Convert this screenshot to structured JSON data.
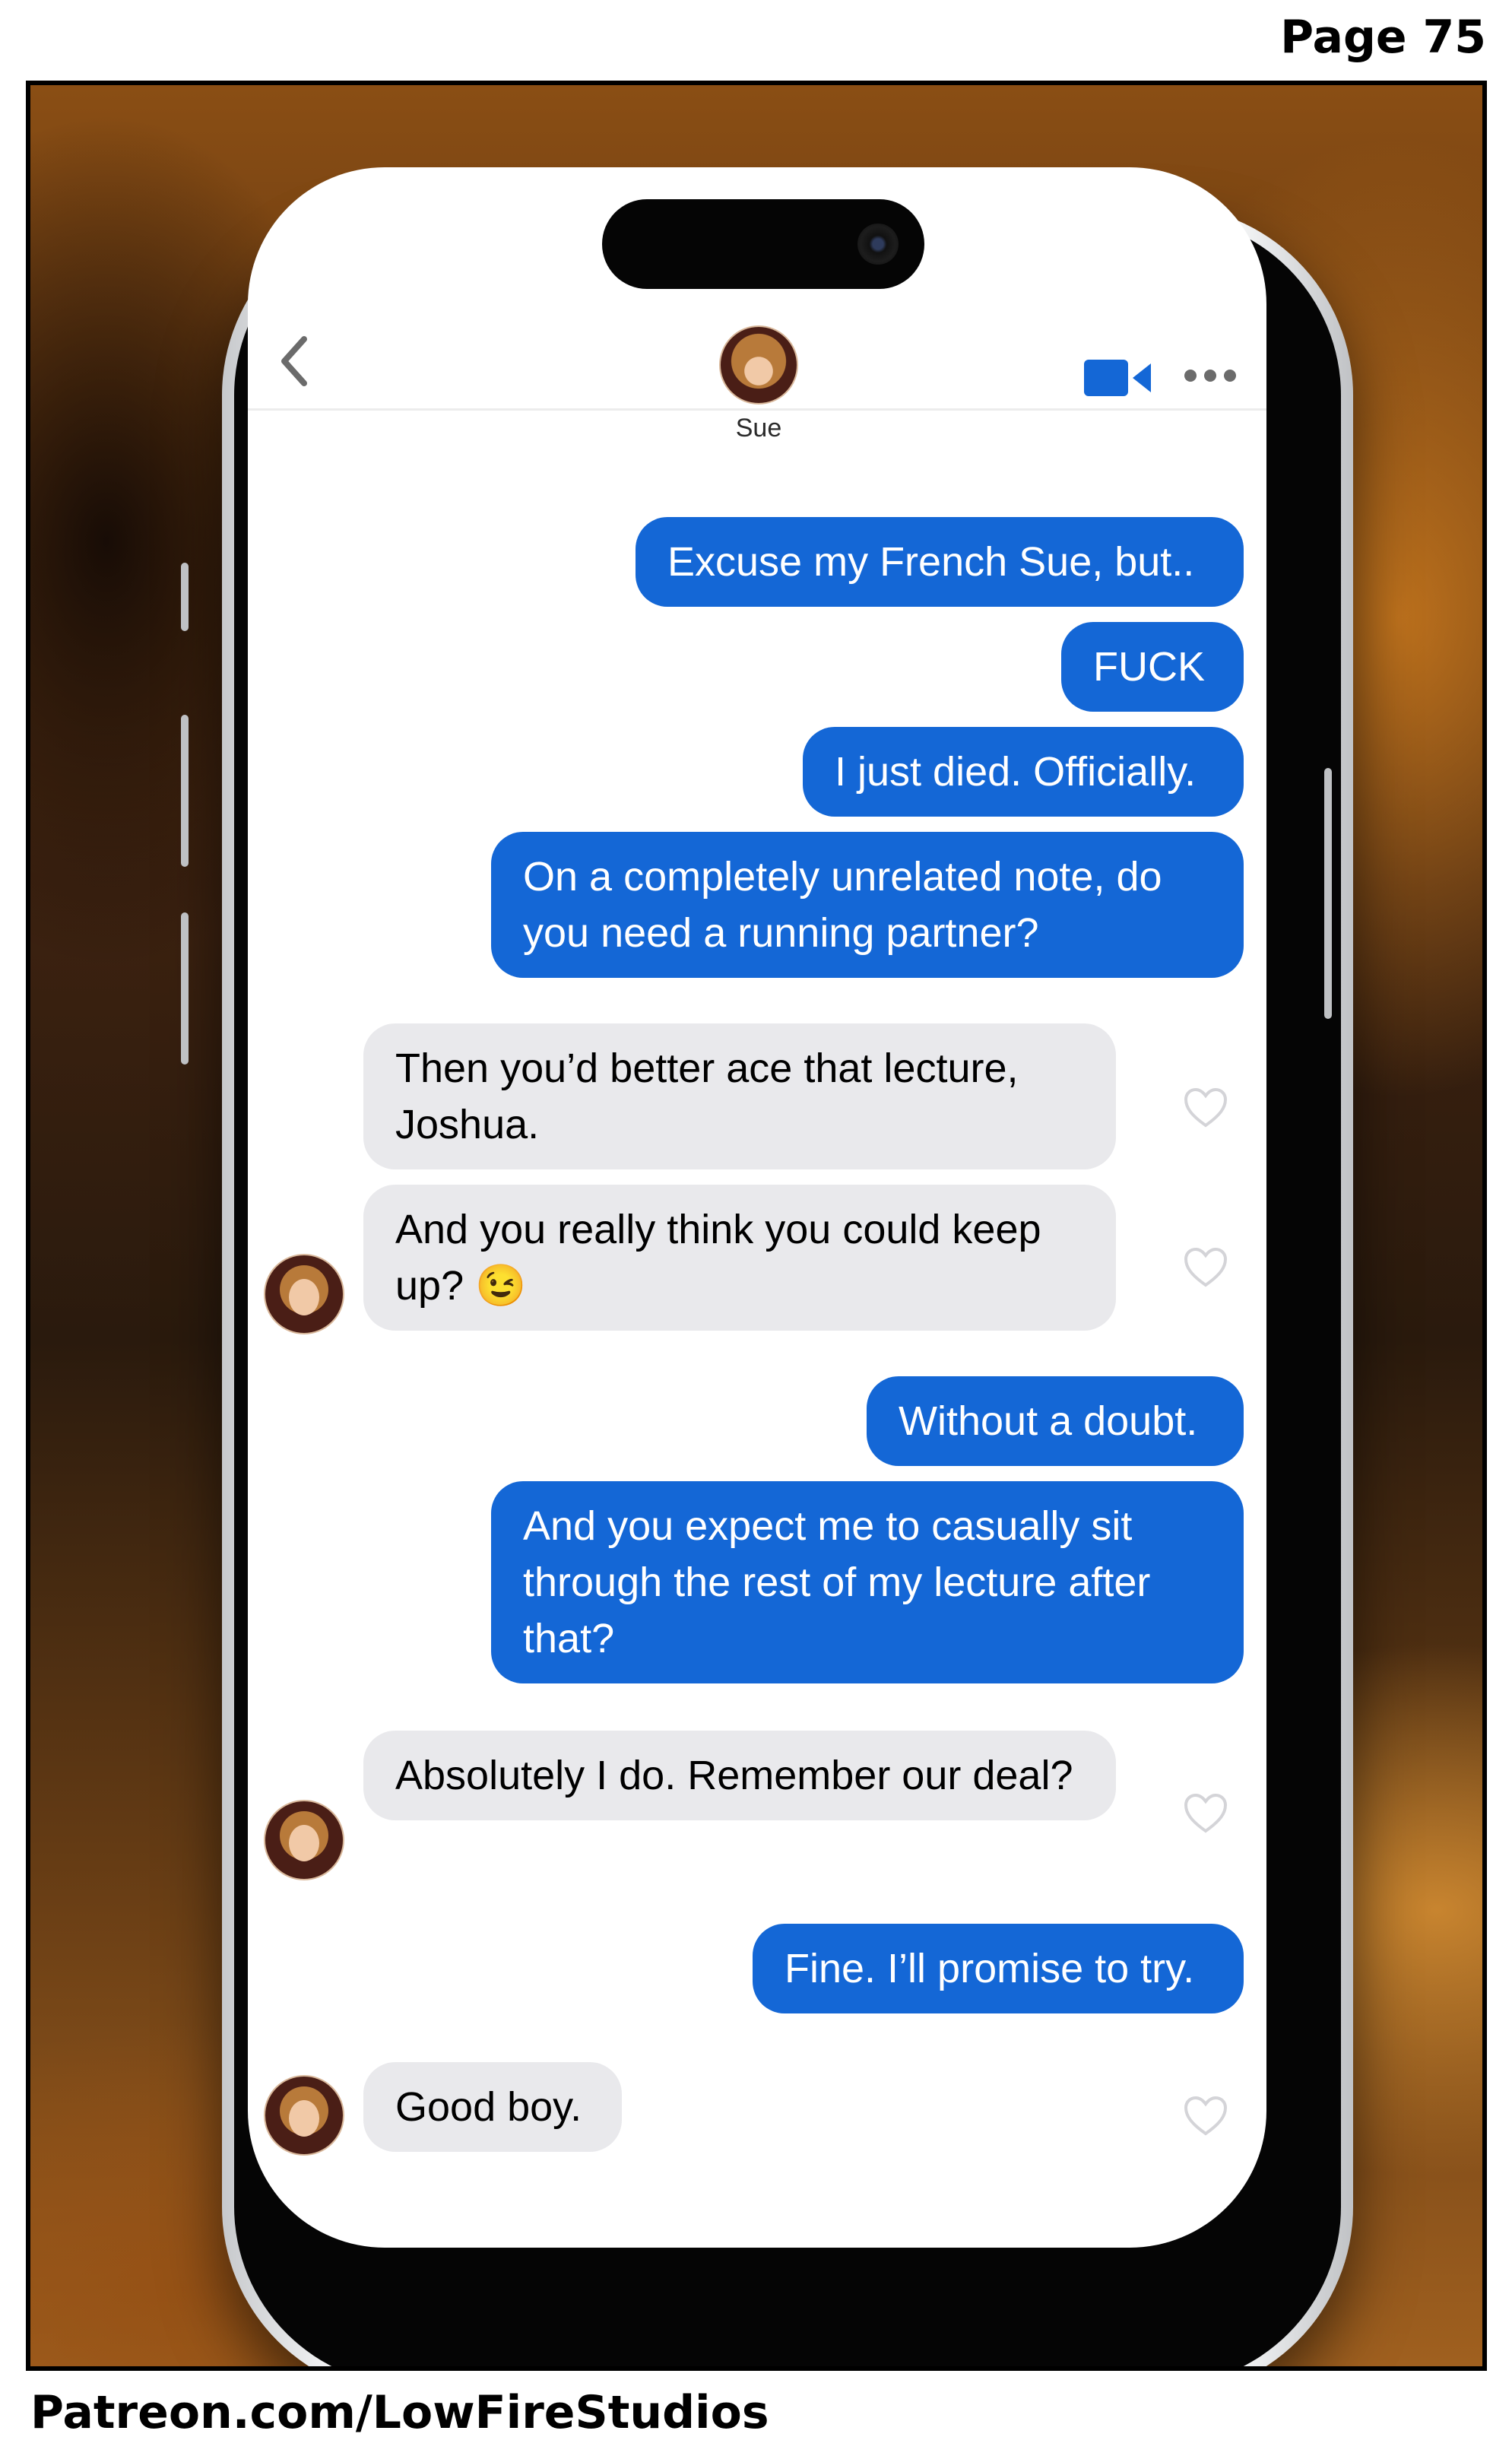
{
  "page_label": "Page 75",
  "footer_text": "Patreon.com/LowFireStudios",
  "colors": {
    "sent_bubble": "#1467d6",
    "received_bubble": "#e9e9ec",
    "accent": "#1467d6"
  },
  "header": {
    "contact_name": "Sue",
    "icons": [
      "chevron-left-icon",
      "avatar",
      "video-camera-icon",
      "more-icon"
    ]
  },
  "messages": [
    {
      "from": "me",
      "text": "Excuse my French Sue, but.."
    },
    {
      "from": "me",
      "text": "FUCK"
    },
    {
      "from": "me",
      "text": "I just died. Officially."
    },
    {
      "from": "me",
      "text": "On a completely unrelated note, do you need a running partner?"
    },
    {
      "from": "sue",
      "text": "Then you’d better ace that lecture, Joshua."
    },
    {
      "from": "sue",
      "text": "And you really think you could keep up? 😉"
    },
    {
      "from": "me",
      "text": "Without a doubt."
    },
    {
      "from": "me",
      "text": "And you expect me to casually sit through the rest of my lecture after that?"
    },
    {
      "from": "sue",
      "text": "Absolutely I do. Remember our deal?"
    },
    {
      "from": "me",
      "text": "Fine. I’ll promise to try."
    },
    {
      "from": "sue",
      "text": "Good boy."
    }
  ]
}
